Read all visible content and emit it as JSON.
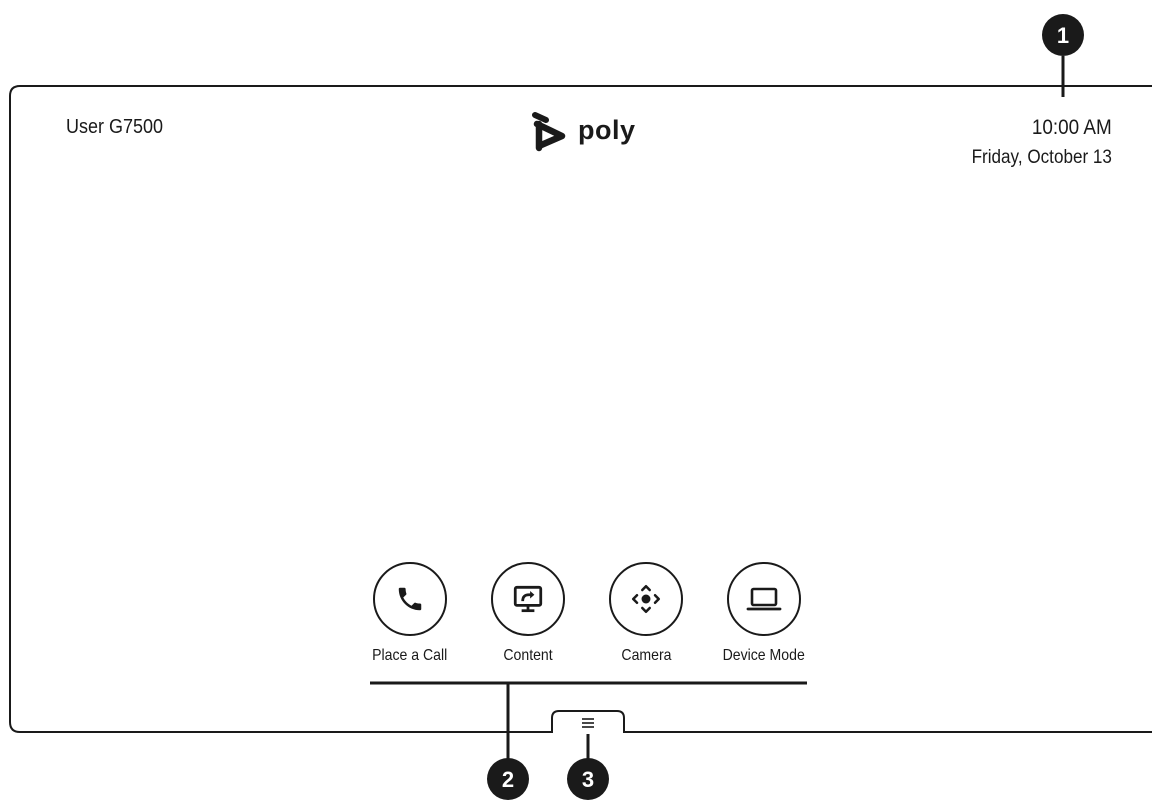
{
  "header": {
    "user_name": "User G7500",
    "logo_text": "poly",
    "time": "10:00 AM",
    "date": "Friday, October 13"
  },
  "actions": [
    {
      "label": "Place a Call",
      "icon": "phone-icon"
    },
    {
      "label": "Content",
      "icon": "share-screen-icon"
    },
    {
      "label": "Camera",
      "icon": "camera-control-icon"
    },
    {
      "label": "Device Mode",
      "icon": "laptop-icon"
    }
  ],
  "menu": {
    "icon": "hamburger-menu-icon"
  },
  "callouts": [
    "1",
    "2",
    "3"
  ],
  "colors": {
    "ink": "#1a1a1a",
    "background": "#ffffff"
  }
}
